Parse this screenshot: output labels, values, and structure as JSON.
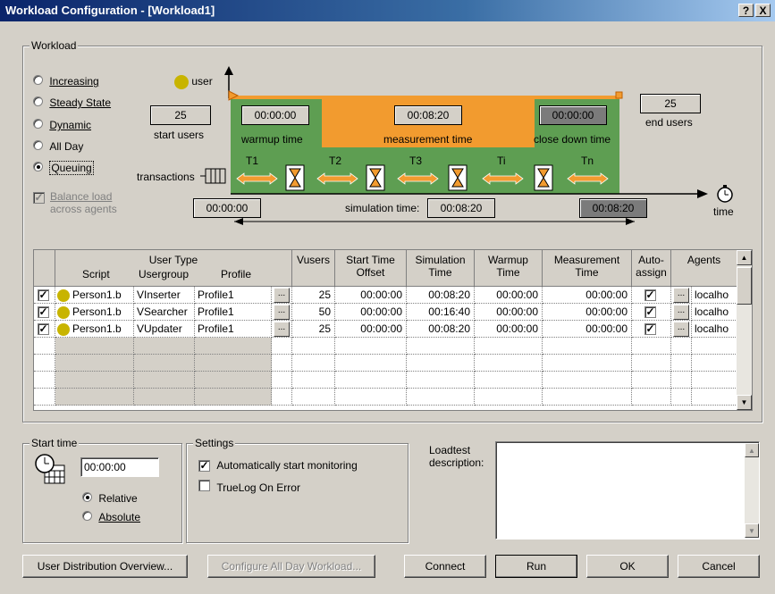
{
  "window": {
    "title": "Workload Configuration - [Workload1]",
    "help_btn": "?",
    "close_btn": "X"
  },
  "workload": {
    "group_label": "Workload",
    "options": [
      {
        "label": "Increasing",
        "selected": false
      },
      {
        "label": "Steady State",
        "selected": false
      },
      {
        "label": "Dynamic",
        "selected": false
      },
      {
        "label": "All Day",
        "selected": false
      },
      {
        "label": "Queuing",
        "selected": true
      }
    ],
    "balance": {
      "line1": "Balance load",
      "line2": "across agents",
      "checked": true,
      "disabled": true
    }
  },
  "diagram": {
    "user_label": "user",
    "start_users": "25",
    "start_users_label": "start users",
    "end_users": "25",
    "end_users_label": "end users",
    "warmup_time": "00:00:00",
    "warmup_label": "warmup time",
    "measurement_time": "00:08:20",
    "measurement_label": "measurement time",
    "closedown_time": "00:00:00",
    "closedown_label": "close down time",
    "transactions_label": "transactions",
    "tx_labels": [
      "T1",
      "T2",
      "T3",
      "Ti",
      "Tn"
    ],
    "sim_start": "00:00:00",
    "simulation_label": "simulation time:",
    "simulation_time": "00:08:20",
    "sim_end": "00:08:20",
    "time_label": "time",
    "colors": {
      "green": "#5e9e52",
      "orange": "#f29b2f",
      "gray": "#7b7b7b"
    }
  },
  "table": {
    "headers": {
      "script": "Script",
      "user_type": "User Type",
      "usergroup": "Usergroup",
      "profile": "Profile",
      "vusers": "Vusers",
      "start_time_1": "Start Time",
      "start_time_2": "Offset",
      "sim_1": "Simulation",
      "sim_2": "Time",
      "warm_1": "Warmup",
      "warm_2": "Time",
      "meas_1": "Measurement",
      "meas_2": "Time",
      "auto_1": "Auto-",
      "auto_2": "assign",
      "agents": "Agents"
    },
    "rows": [
      {
        "checked": true,
        "script": "Person1.b",
        "usergroup": "VInserter",
        "profile": "Profile1",
        "vusers": "25",
        "start": "00:00:00",
        "sim": "00:08:20",
        "warmup": "00:00:00",
        "measure": "00:00:00",
        "auto": true,
        "agent": "localho"
      },
      {
        "checked": true,
        "script": "Person1.b",
        "usergroup": "VSearcher",
        "profile": "Profile1",
        "vusers": "50",
        "start": "00:00:00",
        "sim": "00:16:40",
        "warmup": "00:00:00",
        "measure": "00:00:00",
        "auto": true,
        "agent": "localho"
      },
      {
        "checked": true,
        "script": "Person1.b",
        "usergroup": "VUpdater",
        "profile": "Profile1",
        "vusers": "25",
        "start": "00:00:00",
        "sim": "00:08:20",
        "warmup": "00:00:00",
        "measure": "00:00:00",
        "auto": true,
        "agent": "localho"
      }
    ],
    "ellipsis": "..."
  },
  "start_time": {
    "group_label": "Start time",
    "value": "00:00:00",
    "relative": "Relative",
    "absolute": "Absolute",
    "relative_selected": true
  },
  "settings": {
    "group_label": "Settings",
    "auto_monitor": "Automatically start monitoring",
    "auto_monitor_checked": true,
    "truelog": "TrueLog On Error",
    "truelog_checked": false
  },
  "loadtest": {
    "label_1": "Loadtest",
    "label_2": "description:",
    "value": ""
  },
  "buttons": {
    "user_dist": "User Distribution Overview...",
    "configure_all_day": "Configure All Day Workload...",
    "connect": "Connect",
    "run": "Run",
    "ok": "OK",
    "cancel": "Cancel"
  }
}
